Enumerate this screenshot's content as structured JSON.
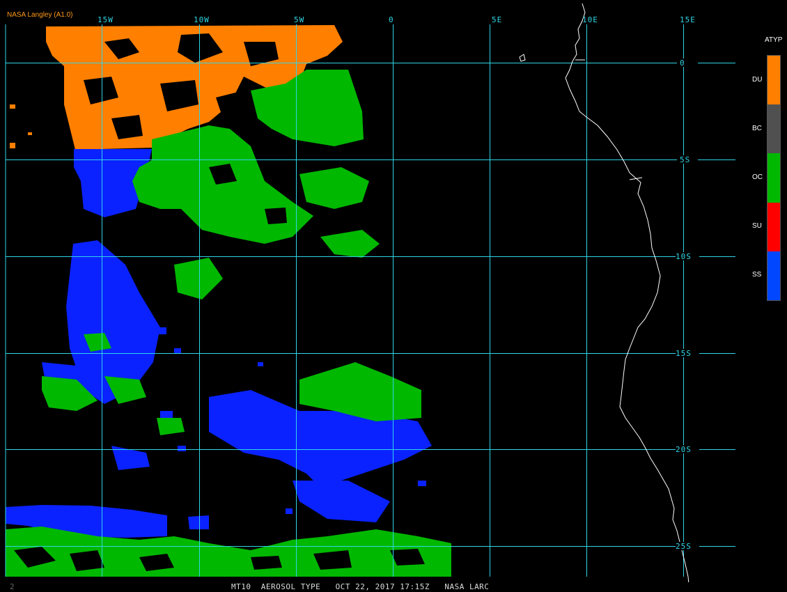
{
  "credit": "NASA Langley (A1.0)",
  "lon_labels": [
    "15W",
    "10W",
    "5W",
    "0",
    "5E",
    "10E",
    "15E"
  ],
  "lat_labels": [
    "0",
    "5S",
    "10S",
    "15S",
    "20S",
    "25S"
  ],
  "legend": {
    "title": "ATYP",
    "items": [
      {
        "label": "DU",
        "color": "#ff7f00"
      },
      {
        "label": "BC",
        "color": "#505050"
      },
      {
        "label": "OC",
        "color": "#00b800"
      },
      {
        "label": "SU",
        "color": "#ff0000"
      },
      {
        "label": "SS",
        "color": "#0047ff"
      }
    ]
  },
  "footer": {
    "frame": "2",
    "product": "MT10",
    "field": "AEROSOL TYPE",
    "datetime": "OCT 22, 2017 17:15Z",
    "source": "NASA LARC"
  },
  "colors": {
    "grid": "#2fd6e6",
    "coast": "#ffffff",
    "background": "#000000"
  }
}
